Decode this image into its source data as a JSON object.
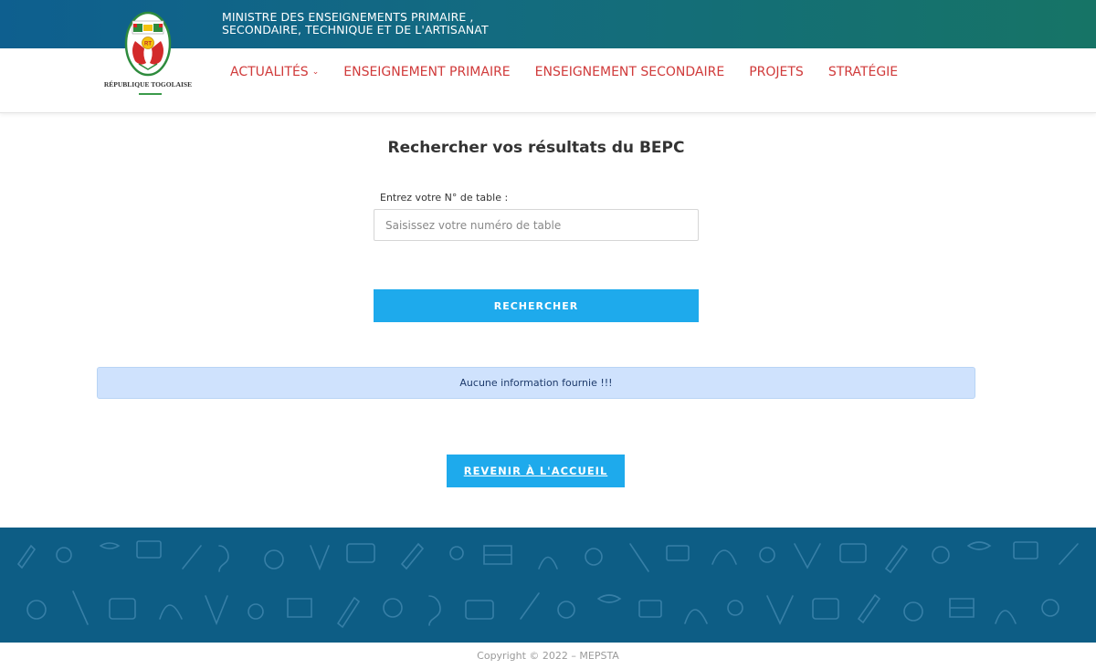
{
  "header": {
    "ministry_line1": "MINISTRE DES ENSEIGNEMENTS PRIMAIRE ,",
    "ministry_line2": "SECONDAIRE, TECHNIQUE ET DE L'ARTISANAT",
    "logo_text": "RÉPUBLIQUE TOGOLAISE",
    "logo_badge": "RT",
    "colors": {
      "topbar_start": "#0e5f8f",
      "topbar_end": "#167466"
    }
  },
  "nav": {
    "items": [
      {
        "label": "ACTUALITÉS",
        "has_dropdown": true,
        "icon": "chevron-down-icon"
      },
      {
        "label": "ENSEIGNEMENT PRIMAIRE"
      },
      {
        "label": "ENSEIGNEMENT SECONDAIRE"
      },
      {
        "label": "PROJETS"
      },
      {
        "label": "STRATÉGIE"
      }
    ],
    "color": "#d03a3a"
  },
  "main": {
    "title": "Rechercher vos résultats du BEPC",
    "field_label": "Entrez votre N° de table :",
    "field_placeholder": "Saisissez votre numéro de table",
    "field_value": "",
    "search_button": "RECHERCHER",
    "alert_text": "Aucune information fournie !!!",
    "home_button": "REVENIR À L'ACCUEIL",
    "accent": "#1eaaec",
    "alert_bg": "#cfe2fd"
  },
  "footer": {
    "copyright": "Copyright © 2022 – MEPSTA",
    "band_color": "#0d5d85"
  }
}
